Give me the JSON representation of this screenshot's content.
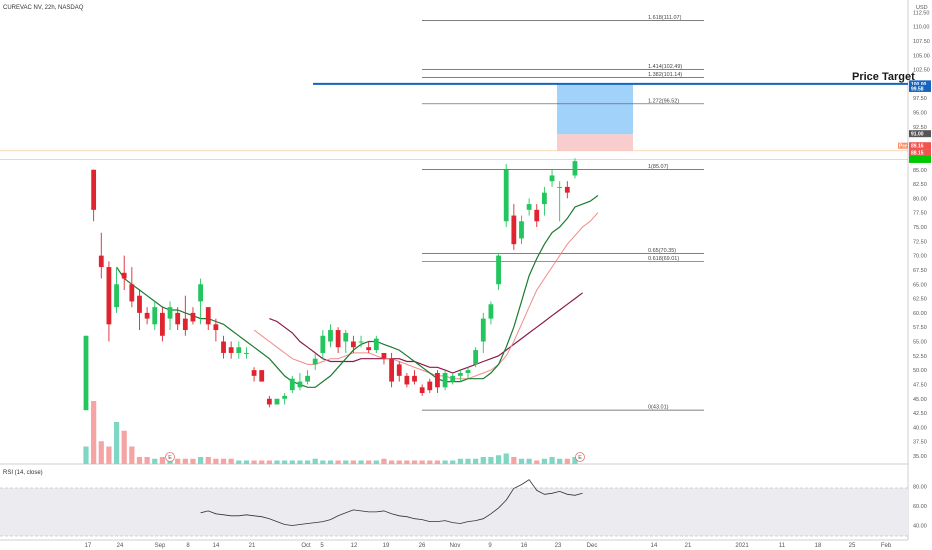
{
  "chart_data": {
    "type": "candlestick",
    "title": "CUREVAC NV, 22h, NASDAQ",
    "currency": "USD",
    "y_axis_ticks": [
      112.5,
      110.0,
      107.5,
      105.0,
      102.5,
      97.5,
      95.0,
      92.5,
      87.5,
      85.0,
      82.5,
      80.0,
      77.5,
      75.0,
      72.5,
      70.0,
      67.5,
      65.0,
      62.5,
      60.0,
      57.5,
      55.0,
      52.5,
      50.0,
      47.5,
      45.0,
      42.5,
      40.0,
      37.5,
      35.0
    ],
    "ylim": [
      33.0,
      115.0
    ],
    "x_axis_ticks": [
      "17",
      "24",
      "Sep",
      "8",
      "14",
      "21",
      "Oct",
      "5",
      "12",
      "19",
      "26",
      "Nov",
      "9",
      "16",
      "23",
      "Dec",
      "14",
      "21",
      "2021",
      "11",
      "18",
      "25",
      "Feb"
    ],
    "candles": [
      {
        "o": 43.0,
        "h": 56.0,
        "l": 43.0,
        "c": 56.0
      },
      {
        "o": 85.0,
        "h": 85.0,
        "l": 76.0,
        "c": 78.0
      },
      {
        "o": 70.0,
        "h": 74.0,
        "l": 66.0,
        "c": 68.0
      },
      {
        "o": 68.0,
        "h": 69.0,
        "l": 55.0,
        "c": 58.0
      },
      {
        "o": 61.0,
        "h": 68.0,
        "l": 60.0,
        "c": 65.0
      },
      {
        "o": 67.0,
        "h": 70.0,
        "l": 64.0,
        "c": 66.0
      },
      {
        "o": 65.0,
        "h": 68.0,
        "l": 61.0,
        "c": 62.0
      },
      {
        "o": 63.0,
        "h": 64.0,
        "l": 57.0,
        "c": 60.0
      },
      {
        "o": 60.0,
        "h": 61.0,
        "l": 58.0,
        "c": 59.0
      },
      {
        "o": 58.0,
        "h": 62.0,
        "l": 57.0,
        "c": 61.0
      },
      {
        "o": 60.0,
        "h": 61.0,
        "l": 55.0,
        "c": 56.0
      },
      {
        "o": 59.0,
        "h": 62.0,
        "l": 57.0,
        "c": 61.0
      },
      {
        "o": 60.0,
        "h": 61.0,
        "l": 57.0,
        "c": 58.0
      },
      {
        "o": 59.0,
        "h": 63.0,
        "l": 56.0,
        "c": 57.0
      },
      {
        "o": 60.0,
        "h": 61.0,
        "l": 58.0,
        "c": 58.5
      },
      {
        "o": 62.0,
        "h": 66.0,
        "l": 58.0,
        "c": 65.0
      },
      {
        "o": 61.0,
        "h": 61.0,
        "l": 57.0,
        "c": 58.0
      },
      {
        "o": 58.0,
        "h": 59.0,
        "l": 55.0,
        "c": 57.0
      },
      {
        "o": 55.0,
        "h": 56.0,
        "l": 52.0,
        "c": 53.0
      },
      {
        "o": 54.0,
        "h": 55.0,
        "l": 52.0,
        "c": 53.0
      },
      {
        "o": 53.0,
        "h": 55.0,
        "l": 52.0,
        "c": 54.0
      },
      {
        "o": 53.0,
        "h": 54.0,
        "l": 52.0,
        "c": 53.0
      },
      {
        "o": 50.0,
        "h": 50.5,
        "l": 48.0,
        "c": 49.0
      },
      {
        "o": 50.0,
        "h": 50.0,
        "l": 48.0,
        "c": 48.0
      },
      {
        "o": 45.0,
        "h": 45.5,
        "l": 43.5,
        "c": 44.0
      },
      {
        "o": 44.0,
        "h": 45.0,
        "l": 44.0,
        "c": 45.0
      },
      {
        "o": 45.0,
        "h": 46.0,
        "l": 44.0,
        "c": 45.5
      },
      {
        "o": 46.5,
        "h": 49.0,
        "l": 46.0,
        "c": 48.5
      },
      {
        "o": 47.0,
        "h": 49.5,
        "l": 46.5,
        "c": 48.0
      },
      {
        "o": 48.0,
        "h": 50.0,
        "l": 47.5,
        "c": 49.0
      },
      {
        "o": 51.0,
        "h": 53.0,
        "l": 50.0,
        "c": 52.0
      },
      {
        "o": 53.0,
        "h": 57.0,
        "l": 52.0,
        "c": 56.0
      },
      {
        "o": 55.0,
        "h": 58.0,
        "l": 54.0,
        "c": 57.0
      },
      {
        "o": 57.0,
        "h": 57.5,
        "l": 53.0,
        "c": 54.0
      },
      {
        "o": 55.0,
        "h": 57.0,
        "l": 53.0,
        "c": 56.5
      },
      {
        "o": 55.0,
        "h": 56.0,
        "l": 53.0,
        "c": 54.0
      },
      {
        "o": 55.0,
        "h": 56.0,
        "l": 54.0,
        "c": 55.0
      },
      {
        "o": 54.0,
        "h": 55.0,
        "l": 53.0,
        "c": 53.5
      },
      {
        "o": 53.5,
        "h": 56.0,
        "l": 53.0,
        "c": 55.5
      },
      {
        "o": 53.0,
        "h": 53.0,
        "l": 51.0,
        "c": 52.0
      },
      {
        "o": 52.0,
        "h": 53.0,
        "l": 47.0,
        "c": 48.0
      },
      {
        "o": 51.0,
        "h": 51.5,
        "l": 48.0,
        "c": 49.0
      },
      {
        "o": 49.0,
        "h": 49.5,
        "l": 47.0,
        "c": 47.5
      },
      {
        "o": 49.0,
        "h": 50.0,
        "l": 47.5,
        "c": 48.0
      },
      {
        "o": 47.0,
        "h": 47.5,
        "l": 45.5,
        "c": 46.0
      },
      {
        "o": 48.0,
        "h": 48.5,
        "l": 46.0,
        "c": 46.5
      },
      {
        "o": 49.5,
        "h": 50.0,
        "l": 46.0,
        "c": 47.0
      },
      {
        "o": 47.0,
        "h": 50.0,
        "l": 46.5,
        "c": 49.5
      },
      {
        "o": 48.0,
        "h": 49.5,
        "l": 47.5,
        "c": 49.0
      },
      {
        "o": 49.0,
        "h": 50.0,
        "l": 48.0,
        "c": 49.5
      },
      {
        "o": 49.5,
        "h": 50.5,
        "l": 48.5,
        "c": 50.0
      },
      {
        "o": 51.0,
        "h": 54.0,
        "l": 50.5,
        "c": 53.5
      },
      {
        "o": 55.0,
        "h": 60.0,
        "l": 53.0,
        "c": 59.0
      },
      {
        "o": 59.0,
        "h": 62.0,
        "l": 58.0,
        "c": 61.5
      },
      {
        "o": 65.0,
        "h": 70.5,
        "l": 64.0,
        "c": 70.0
      },
      {
        "o": 76.0,
        "h": 86.0,
        "l": 75.0,
        "c": 85.0
      },
      {
        "o": 77.0,
        "h": 79.0,
        "l": 71.0,
        "c": 72.0
      },
      {
        "o": 73.0,
        "h": 77.0,
        "l": 72.0,
        "c": 76.0
      },
      {
        "o": 78.0,
        "h": 80.0,
        "l": 77.0,
        "c": 79.0
      },
      {
        "o": 78.0,
        "h": 79.0,
        "l": 75.0,
        "c": 76.0
      },
      {
        "o": 79.0,
        "h": 82.0,
        "l": 77.0,
        "c": 81.0
      },
      {
        "o": 83.0,
        "h": 85.0,
        "l": 82.0,
        "c": 84.0
      },
      {
        "o": 82.0,
        "h": 83.0,
        "l": 76.0,
        "c": 82.0
      },
      {
        "o": 82.0,
        "h": 83.0,
        "l": 80.0,
        "c": 81.0
      },
      {
        "o": 84.0,
        "h": 87.0,
        "l": 83.5,
        "c": 86.5
      }
    ],
    "volume": [
      10,
      36,
      13,
      10,
      24,
      19,
      10,
      4,
      4,
      3,
      4,
      3,
      3,
      3,
      3,
      4,
      4,
      3,
      3,
      3,
      2,
      2,
      2,
      2,
      2,
      2,
      2,
      2,
      2,
      2,
      3,
      2,
      2,
      2,
      2,
      2,
      2,
      2,
      2,
      3,
      2,
      2,
      2,
      2,
      2,
      2,
      2,
      2,
      2,
      3,
      3,
      3,
      4,
      4,
      5,
      6,
      4,
      3,
      3,
      2,
      3,
      4,
      3,
      3,
      4
    ],
    "ma_fast": {
      "start": 4,
      "values": [
        68.0,
        66.0,
        65.0,
        64.0,
        63.0,
        62.0,
        61.0,
        60.5,
        60.5,
        60.0,
        59.5,
        59.0,
        59.0,
        58.5,
        58.0,
        57.0,
        56.0,
        55.0,
        54.0,
        53.0,
        52.0,
        50.5,
        49.0,
        48.0,
        47.5,
        47.0,
        47.0,
        48.0,
        49.0,
        50.5,
        52.0,
        53.5,
        54.5,
        55.0,
        55.0,
        54.5,
        54.0,
        53.5,
        52.5,
        51.5,
        50.5,
        49.5,
        48.5,
        48.0,
        48.0,
        48.0,
        48.5,
        48.5,
        48.5,
        49.5,
        51.0,
        54.0,
        57.5,
        62.0,
        66.5,
        69.5,
        72.0,
        74.0,
        75.0,
        76.5,
        78.5,
        79.0,
        79.5,
        80.5
      ]
    },
    "ma_mid": {
      "start": 22,
      "values": [
        57.0,
        56.0,
        55.0,
        54.0,
        53.0,
        52.0,
        51.5,
        51.0,
        51.0,
        51.5,
        52.0,
        52.0,
        52.5,
        53.0,
        53.0,
        53.0,
        52.5,
        52.0,
        52.0,
        51.5,
        51.0,
        50.5,
        50.0,
        49.5,
        49.0,
        49.0,
        48.5,
        48.5,
        48.5,
        49.0,
        49.5,
        50.0,
        51.0,
        52.5,
        55.0,
        58.0,
        61.0,
        64.0,
        66.0,
        68.0,
        70.0,
        72.0,
        73.5,
        75.0,
        76.0,
        77.5
      ]
    },
    "ma_slow": {
      "start": 24,
      "values": [
        59.0,
        58.5,
        57.5,
        56.5,
        55.0,
        54.0,
        53.0,
        52.0,
        51.5,
        51.5,
        51.5,
        51.5,
        52.0,
        52.0,
        52.0,
        52.0,
        52.0,
        52.0,
        51.5,
        51.5,
        51.0,
        50.5,
        50.5,
        50.0,
        49.5,
        50.0,
        50.5,
        51.0,
        51.5,
        52.0,
        52.5,
        53.5,
        54.5,
        55.5,
        56.5,
        57.5,
        58.5,
        59.5,
        60.5,
        61.5,
        62.5,
        63.5
      ]
    },
    "rsi": {
      "label": "RSI (14, close)",
      "start": 15,
      "ticks": [
        80.0,
        60.0,
        40.0
      ],
      "band": [
        70,
        30
      ],
      "ylim": [
        25,
        95
      ],
      "values": [
        53,
        55,
        52,
        51,
        50,
        50,
        51,
        50,
        49,
        47,
        44,
        41,
        40,
        41,
        42,
        43,
        44,
        46,
        50,
        53,
        56,
        55,
        54,
        54,
        55,
        52,
        50,
        49,
        47,
        46,
        44,
        44,
        45,
        43,
        42,
        44,
        45,
        47,
        52,
        58,
        66,
        78,
        82,
        87,
        76,
        72,
        73,
        75,
        72,
        71,
        73
      ]
    },
    "fib_levels": [
      {
        "label": "1.618(111.07)",
        "value": 111.07
      },
      {
        "label": "1.414(102.49)",
        "value": 102.49
      },
      {
        "label": "1.382(101.14)",
        "value": 101.14
      },
      {
        "label": "1.272(96.52)",
        "value": 96.52
      },
      {
        "label": "1(85.07)",
        "value": 85.07
      },
      {
        "label": "0.65(70.35)",
        "value": 70.35
      },
      {
        "label": "0.618(69.01)",
        "value": 69.01
      },
      {
        "label": "0(43.01)",
        "value": 43.01
      }
    ],
    "price_target": {
      "label": "Price Target",
      "value": 100.0
    },
    "target_box": {
      "top": 100.0,
      "bottom": 91.2
    },
    "stop_box": {
      "top": 91.2,
      "bottom": 88.3
    },
    "price_tags": [
      {
        "text": "100.00",
        "value": 100.0,
        "color": "#1565c0"
      },
      {
        "text": "99.58",
        "value": 99.2,
        "color": "#1565c0"
      },
      {
        "text": "91.00",
        "value": 91.3,
        "color": "#555555"
      },
      {
        "text": "89.16",
        "value": 89.2,
        "color": "#ef5350"
      },
      {
        "text": "88.15",
        "value": 88.0,
        "color": "#ef5350"
      },
      {
        "text": "",
        "value": 86.8,
        "color": "#00c800"
      }
    ],
    "pre_label": "Pre",
    "event_markers": [
      "E",
      "E"
    ],
    "colors": {
      "up": "#22c55e",
      "down": "#e0242f",
      "ma_fast": "#1b7a2f",
      "ma_mid": "#f08a8a",
      "ma_slow": "#8b1a4a",
      "target": "#1565c0",
      "rsi_line": "#333333"
    }
  }
}
